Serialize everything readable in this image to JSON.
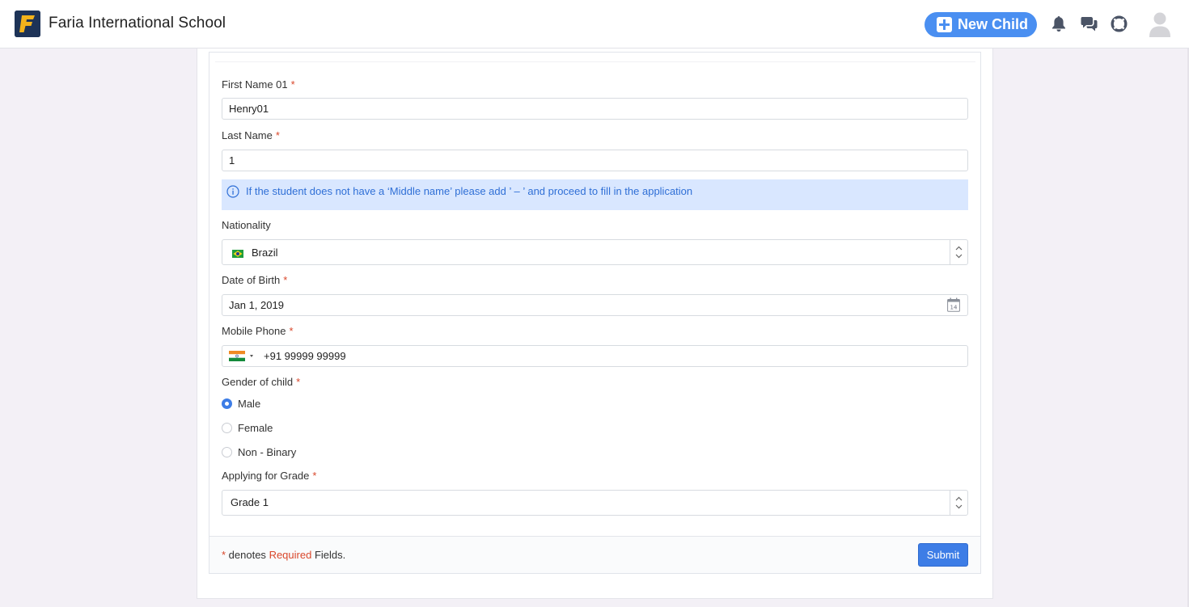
{
  "header": {
    "school_name": "Faria International School",
    "new_child_label": "New Child",
    "icons": [
      "bell-icon",
      "chat-icon",
      "help-lifebuoy-icon",
      "user-avatar-icon"
    ]
  },
  "form": {
    "first_name": {
      "label": "First Name 01",
      "value": "Henry01",
      "required_mark": "*"
    },
    "last_name": {
      "label": "Last Name",
      "value": "1",
      "required_mark": "*"
    },
    "info_text": "If the student does not have a ‘Middle name’ please add ’ – ’ and proceed to fill in the application",
    "nationality": {
      "label": "Nationality",
      "value": "Brazil"
    },
    "date_of_birth": {
      "label": "Date of Birth",
      "value": "Jan 1, 2019",
      "required_mark": "*",
      "calendar_day": "14"
    },
    "mobile_phone": {
      "label": "Mobile Phone",
      "value": "+91 99999 99999",
      "required_mark": "*"
    },
    "gender": {
      "label": "Gender of child",
      "required_mark": "*",
      "options": [
        "Male",
        "Female",
        "Non - Binary"
      ],
      "selected": "Male"
    },
    "grade": {
      "label": "Applying for Grade",
      "value": "Grade 1",
      "required_mark": "*"
    }
  },
  "footer": {
    "note_star": "*",
    "note_prefix": " denotes ",
    "note_required": "Required",
    "note_suffix": " Fields.",
    "submit_label": "Submit"
  },
  "colors": {
    "accent": "#3d7de6",
    "new_child_bg": "#4a8ff1",
    "required_red": "#d9472b",
    "info_bg": "#d9e7ff",
    "page_bg": "#f3f0f6"
  }
}
